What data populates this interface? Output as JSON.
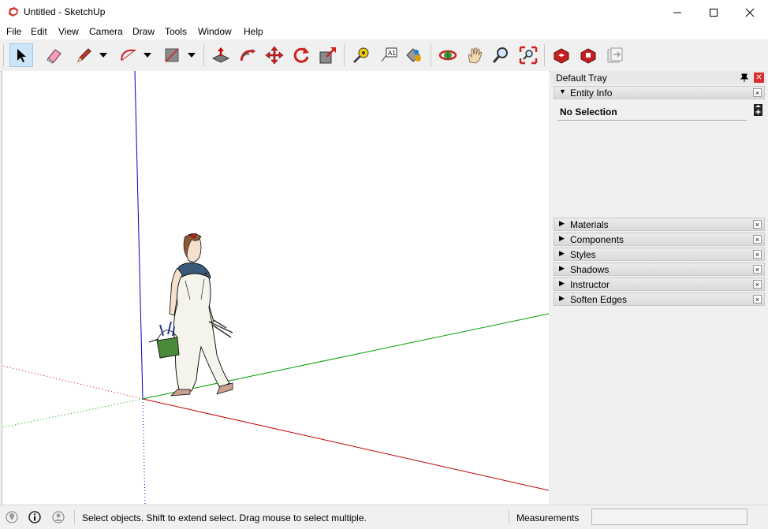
{
  "window": {
    "title": "Untitled - SketchUp",
    "controls": [
      "minimize",
      "maximize",
      "close"
    ]
  },
  "menu": [
    "File",
    "Edit",
    "View",
    "Camera",
    "Draw",
    "Tools",
    "Window",
    "Help"
  ],
  "toolbar": {
    "tools": [
      "select",
      "eraser",
      "pencil-line",
      "arc",
      "rectangle",
      "push-pull",
      "follow-me",
      "move",
      "rotate",
      "scale",
      "tape-measure",
      "text",
      "paint-bucket",
      "orbit",
      "pan",
      "zoom",
      "zoom-extents",
      "3d-warehouse",
      "extension-warehouse",
      "layout"
    ],
    "active": "select"
  },
  "tray": {
    "title": "Default Tray",
    "entity_info": {
      "label": "Entity Info",
      "selection": "No Selection"
    },
    "panels": [
      "Materials",
      "Components",
      "Styles",
      "Shadows",
      "Instructor",
      "Soften Edges"
    ]
  },
  "statusbar": {
    "message": "Select objects. Shift to extend select. Drag mouse to select multiple.",
    "measurements_label": "Measurements",
    "measurements_value": ""
  },
  "colors": {
    "red_axis": "#c00000",
    "green_axis": "#00a000",
    "blue_axis": "#0000c0",
    "accent": "#cc2b2b"
  }
}
